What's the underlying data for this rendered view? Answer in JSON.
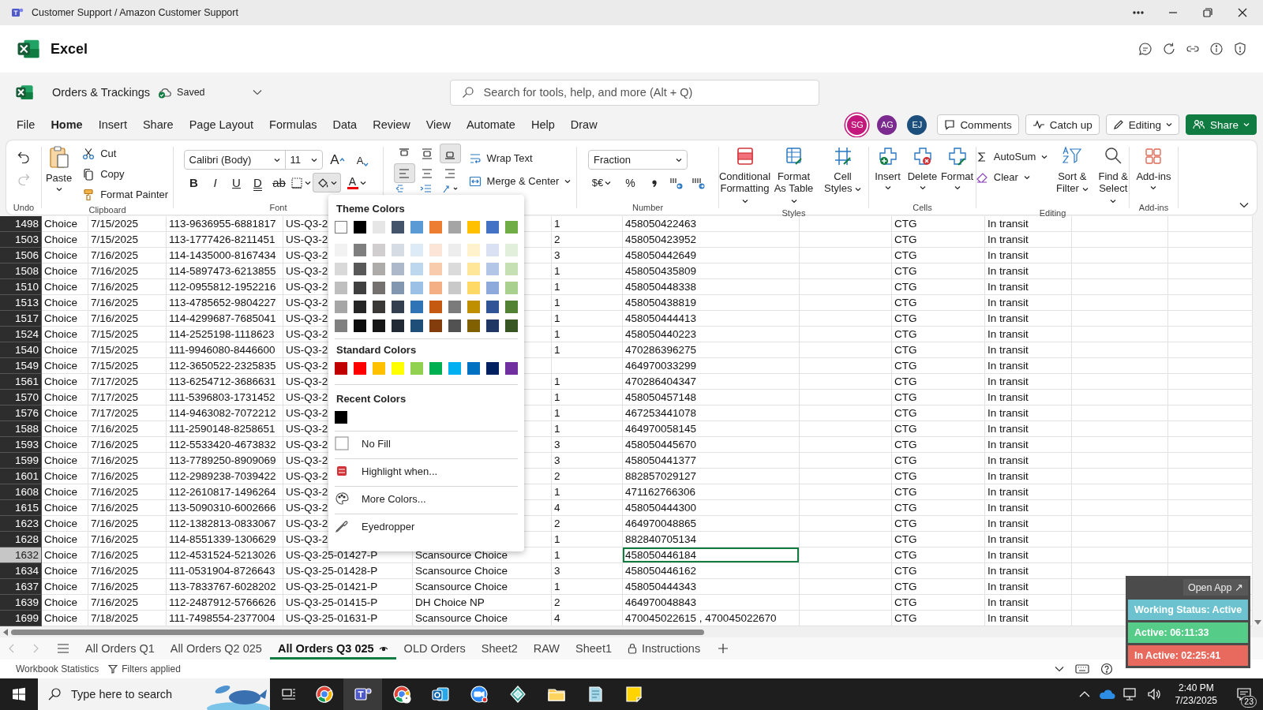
{
  "window": {
    "title": "Customer Support / Amazon Customer Support"
  },
  "app": {
    "name": "Excel"
  },
  "document": {
    "name": "Orders & Trackings",
    "status": "Saved"
  },
  "search": {
    "placeholder": "Search for tools, help, and more (Alt + Q)"
  },
  "menu": [
    {
      "label": "File",
      "selected": false
    },
    {
      "label": "Home",
      "selected": true
    },
    {
      "label": "Insert",
      "selected": false
    },
    {
      "label": "Share",
      "selected": false
    },
    {
      "label": "Page Layout",
      "selected": false
    },
    {
      "label": "Formulas",
      "selected": false
    },
    {
      "label": "Data",
      "selected": false
    },
    {
      "label": "Review",
      "selected": false
    },
    {
      "label": "View",
      "selected": false
    },
    {
      "label": "Automate",
      "selected": false
    },
    {
      "label": "Help",
      "selected": false
    },
    {
      "label": "Draw",
      "selected": false
    }
  ],
  "collaborators": [
    {
      "initials": "SG",
      "color": "#c4177b"
    },
    {
      "initials": "AG",
      "color": "#7b2a8f"
    },
    {
      "initials": "EJ",
      "color": "#1d4f7c"
    }
  ],
  "header_buttons": [
    "Comments",
    "Catch up",
    "Editing"
  ],
  "share_button": "Share",
  "ribbon": {
    "undo": {
      "label": "Undo"
    },
    "clipboard": {
      "label": "Clipboard",
      "paste": "Paste",
      "items": [
        "Cut",
        "Copy",
        "Format Painter"
      ]
    },
    "font": {
      "label": "Font",
      "family": "Calibri (Body)",
      "size": "11",
      "grow": "A",
      "shrink": "A",
      "styles": [
        "B",
        "I",
        "U",
        "D",
        "ab"
      ],
      "color_letter": "A"
    },
    "alignment": {
      "vertical": [
        {
          "selected": false
        },
        {
          "selected": false
        },
        {
          "selected": true
        }
      ],
      "horizontal": [
        {
          "selected": true
        },
        {
          "selected": false
        },
        {
          "selected": false
        }
      ],
      "wrap": "Wrap Text",
      "merge": "Merge & Center"
    },
    "number": {
      "label": "Number",
      "format": "Fraction",
      "currency": "$€",
      "percent": "%"
    },
    "styles": {
      "label": "Styles",
      "items": [
        "Conditional Formatting",
        "Format As Table",
        "Cell Styles"
      ]
    },
    "cells": {
      "label": "Cells",
      "items": [
        "Insert",
        "Delete",
        "Format"
      ]
    },
    "editing": {
      "label": "Editing",
      "autosum": "AutoSum",
      "clear": "Clear",
      "items": [
        "Sort & Filter",
        "Find & Select"
      ]
    },
    "addins": {
      "label": "Add-ins",
      "button": "Add-ins"
    }
  },
  "rows": [
    {
      "row": "1498",
      "selected": false,
      "column_1": "Choice",
      "column_2": "7/15/2025",
      "column_3": "113-9636955-6881817",
      "column_4": "US-Q3-2",
      "column_6": "1",
      "column_7": "458050422463",
      "column_9": "CTG",
      "column_10": "In transit"
    },
    {
      "row": "1503",
      "selected": false,
      "column_1": "Choice",
      "column_2": "7/15/2025",
      "column_3": "113-1777426-8211451",
      "column_4": "US-Q3-2",
      "column_6": "2",
      "column_7": "458050423952",
      "column_9": "CTG",
      "column_10": "In transit"
    },
    {
      "row": "1506",
      "selected": false,
      "column_1": "Choice",
      "column_2": "7/16/2025",
      "column_3": "114-1435000-8167434",
      "column_4": "US-Q3-2",
      "column_6": "3",
      "column_7": "458050442649",
      "column_9": "CTG",
      "column_10": "In transit"
    },
    {
      "row": "1508",
      "selected": false,
      "column_1": "Choice",
      "column_2": "7/16/2025",
      "column_3": "114-5897473-6213855",
      "column_4": "US-Q3-2",
      "column_6": "1",
      "column_7": "458050435809",
      "column_9": "CTG",
      "column_10": "In transit"
    },
    {
      "row": "1510",
      "selected": false,
      "column_1": "Choice",
      "column_2": "7/16/2025",
      "column_3": "112-0955812-1952216",
      "column_4": "US-Q3-2",
      "column_6": "1",
      "column_7": "458050448338",
      "column_9": "CTG",
      "column_10": "In transit"
    },
    {
      "row": "1513",
      "selected": false,
      "column_1": "Choice",
      "column_2": "7/16/2025",
      "column_3": "113-4785652-9804227",
      "column_4": "US-Q3-2",
      "column_6": "1",
      "column_7": "458050438819",
      "column_9": "CTG",
      "column_10": "In transit"
    },
    {
      "row": "1517",
      "selected": false,
      "column_1": "Choice",
      "column_2": "7/16/2025",
      "column_3": "114-4299687-7685041",
      "column_4": "US-Q3-2",
      "column_6": "1",
      "column_7": "458050444413",
      "column_9": "CTG",
      "column_10": "In transit"
    },
    {
      "row": "1524",
      "selected": false,
      "column_1": "Choice",
      "column_2": "7/15/2025",
      "column_3": "114-2525198-1118623",
      "column_4": "US-Q3-2",
      "column_6": "1",
      "column_7": "458050440223",
      "column_9": "CTG",
      "column_10": "In transit"
    },
    {
      "row": "1540",
      "selected": false,
      "column_1": "Choice",
      "column_2": "7/15/2025",
      "column_3": "111-9946080-8446600",
      "column_4": "US-Q3-2",
      "column_6": "1",
      "column_7": "470286396275",
      "column_9": "CTG",
      "column_10": "In transit"
    },
    {
      "row": "1549",
      "selected": false,
      "column_1": "Choice",
      "column_2": "7/15/2025",
      "column_3": "112-3650522-2325835",
      "column_4": "US-Q3-2",
      "column_7": "464970033299",
      "column_9": "CTG",
      "column_10": "In transit"
    },
    {
      "row": "1561",
      "selected": false,
      "column_1": "Choice",
      "column_2": "7/17/2025",
      "column_3": "113-6254712-3686631",
      "column_4": "US-Q3-2",
      "column_6": "1",
      "column_7": "470286404347",
      "column_9": "CTG",
      "column_10": "In transit"
    },
    {
      "row": "1570",
      "selected": false,
      "column_1": "Choice",
      "column_2": "7/17/2025",
      "column_3": "111-5396803-1731452",
      "column_4": "US-Q3-2",
      "column_6": "1",
      "column_7": "458050457148",
      "column_9": "CTG",
      "column_10": "In transit"
    },
    {
      "row": "1576",
      "selected": false,
      "column_1": "Choice",
      "column_2": "7/17/2025",
      "column_3": "114-9463082-7072212",
      "column_4": "US-Q3-2",
      "column_6": "1",
      "column_7": "467253441078",
      "column_9": "CTG",
      "column_10": "In transit"
    },
    {
      "row": "1588",
      "selected": false,
      "column_1": "Choice",
      "column_2": "7/16/2025",
      "column_3": "111-2590148-8258651",
      "column_4": "US-Q3-2",
      "column_6": "1",
      "column_7": "464970058145",
      "column_9": "CTG",
      "column_10": "In transit"
    },
    {
      "row": "1593",
      "selected": false,
      "column_1": "Choice",
      "column_2": "7/16/2025",
      "column_3": "112-5533420-4673832",
      "column_4": "US-Q3-2",
      "column_6": "3",
      "column_7": "458050445670",
      "column_9": "CTG",
      "column_10": "In transit"
    },
    {
      "row": "1599",
      "selected": false,
      "column_1": "Choice",
      "column_2": "7/16/2025",
      "column_3": "113-7789250-8909069",
      "column_4": "US-Q3-2",
      "column_6": "3",
      "column_7": "458050441377",
      "column_9": "CTG",
      "column_10": "In transit"
    },
    {
      "row": "1601",
      "selected": false,
      "column_1": "Choice",
      "column_2": "7/16/2025",
      "column_3": "112-2989238-7039422",
      "column_4": "US-Q3-2",
      "column_6": "2",
      "column_7": "882857029127",
      "column_9": "CTG",
      "column_10": "In transit"
    },
    {
      "row": "1608",
      "selected": false,
      "column_1": "Choice",
      "column_2": "7/16/2025",
      "column_3": "112-2610817-1496264",
      "column_4": "US-Q3-2",
      "column_6": "1",
      "column_7": "471162766306",
      "column_9": "CTG",
      "column_10": "In transit"
    },
    {
      "row": "1615",
      "selected": false,
      "column_1": "Choice",
      "column_2": "7/16/2025",
      "column_3": "113-5090310-6002666",
      "column_4": "US-Q3-2",
      "column_6": "4",
      "column_7": "458050444300",
      "column_9": "CTG",
      "column_10": "In transit"
    },
    {
      "row": "1623",
      "selected": false,
      "column_1": "Choice",
      "column_2": "7/16/2025",
      "column_3": "112-1382813-0833067",
      "column_4": "US-Q3-2",
      "column_6": "2",
      "column_7": "464970048865",
      "column_9": "CTG",
      "column_10": "In transit"
    },
    {
      "row": "1628",
      "selected": false,
      "column_1": "Choice",
      "column_2": "7/16/2025",
      "column_3": "114-8551339-1306629",
      "column_4": "US-Q3-2",
      "column_6": "1",
      "column_7": "882840705134",
      "column_9": "CTG",
      "column_10": "In transit"
    },
    {
      "row": "1632",
      "selected": true,
      "column_1": "Choice",
      "column_2": "7/16/2025",
      "column_3": "112-4531524-5213026",
      "column_4": "US-Q3-25-01427-P",
      "column_5": "Scansource Choice",
      "column_6": "1",
      "column_7": "458050446184",
      "column_9": "CTG",
      "column_10": "In transit"
    },
    {
      "row": "1634",
      "selected": false,
      "column_1": "Choice",
      "column_2": "7/16/2025",
      "column_3": "111-0531904-8726643",
      "column_4": "US-Q3-25-01428-P",
      "column_5": "Scansource Choice",
      "column_6": "3",
      "column_7": "458050446162",
      "column_9": "CTG",
      "column_10": "In transit"
    },
    {
      "row": "1637",
      "selected": false,
      "column_1": "Choice",
      "column_2": "7/16/2025",
      "column_3": "113-7833767-6028202",
      "column_4": "US-Q3-25-01421-P",
      "column_5": "Scansource Choice",
      "column_6": "1",
      "column_7": "458050444343",
      "column_9": "CTG",
      "column_10": "In transit"
    },
    {
      "row": "1639",
      "selected": false,
      "column_1": "Choice",
      "column_2": "7/16/2025",
      "column_3": "112-2487912-5766626",
      "column_4": "US-Q3-25-01415-P",
      "column_5": "DH Choice NP",
      "column_6": "2",
      "column_7": "464970048843",
      "column_9": "CTG",
      "column_10": "In transit"
    },
    {
      "row": "1699",
      "selected": false,
      "column_1": "Choice",
      "column_2": "7/18/2025",
      "column_3": "111-7498554-2377004",
      "column_4": "US-Q3-25-01631-P",
      "column_5": "Scansource Choice",
      "column_6": "4",
      "column_7": "470045022615 , 470045022670",
      "column_9": "CTG",
      "column_10": "In transit"
    }
  ],
  "fill_menu": {
    "theme_title": "Theme Colors",
    "theme_colors": [
      [
        {
          "color": "#ffffff",
          "selected": true
        },
        {
          "color": "#000000",
          "selected": false
        },
        {
          "color": "#e7e6e6",
          "selected": false
        },
        {
          "color": "#44546a",
          "selected": false
        },
        {
          "color": "#5b9bd5",
          "selected": false
        },
        {
          "color": "#ed7d31",
          "selected": false
        },
        {
          "color": "#a5a5a5",
          "selected": false
        },
        {
          "color": "#ffc000",
          "selected": false
        },
        {
          "color": "#4472c4",
          "selected": false
        },
        {
          "color": "#70ad47",
          "selected": false
        }
      ],
      [
        {
          "color": "#f2f2f2",
          "selected": false
        },
        {
          "color": "#7f7f7f",
          "selected": false
        },
        {
          "color": "#d0cece",
          "selected": false
        },
        {
          "color": "#d6dce4",
          "selected": false
        },
        {
          "color": "#ddebf7",
          "selected": false
        },
        {
          "color": "#fce4d6",
          "selected": false
        },
        {
          "color": "#ededed",
          "selected": false
        },
        {
          "color": "#fff2cc",
          "selected": false
        },
        {
          "color": "#d9e1f2",
          "selected": false
        },
        {
          "color": "#e2efda",
          "selected": false
        }
      ],
      [
        {
          "color": "#d9d9d9",
          "selected": false
        },
        {
          "color": "#595959",
          "selected": false
        },
        {
          "color": "#aeabab",
          "selected": false
        },
        {
          "color": "#adb9ca",
          "selected": false
        },
        {
          "color": "#bdd7ee",
          "selected": false
        },
        {
          "color": "#f8cbad",
          "selected": false
        },
        {
          "color": "#dbdbdb",
          "selected": false
        },
        {
          "color": "#ffe699",
          "selected": false
        },
        {
          "color": "#b4c6e7",
          "selected": false
        },
        {
          "color": "#c6e0b4",
          "selected": false
        }
      ],
      [
        {
          "color": "#bfbfbf",
          "selected": false
        },
        {
          "color": "#404040",
          "selected": false
        },
        {
          "color": "#757171",
          "selected": false
        },
        {
          "color": "#8497b0",
          "selected": false
        },
        {
          "color": "#9bc2e6",
          "selected": false
        },
        {
          "color": "#f4b084",
          "selected": false
        },
        {
          "color": "#c9c9c9",
          "selected": false
        },
        {
          "color": "#ffd966",
          "selected": false
        },
        {
          "color": "#8ea9db",
          "selected": false
        },
        {
          "color": "#a9d08e",
          "selected": false
        }
      ],
      [
        {
          "color": "#a6a6a6",
          "selected": false
        },
        {
          "color": "#262626",
          "selected": false
        },
        {
          "color": "#3b3838",
          "selected": false
        },
        {
          "color": "#333f4f",
          "selected": false
        },
        {
          "color": "#2f75b5",
          "selected": false
        },
        {
          "color": "#c65911",
          "selected": false
        },
        {
          "color": "#7b7b7b",
          "selected": false
        },
        {
          "color": "#bf8f00",
          "selected": false
        },
        {
          "color": "#305496",
          "selected": false
        },
        {
          "color": "#548235",
          "selected": false
        }
      ],
      [
        {
          "color": "#808080",
          "selected": false
        },
        {
          "color": "#0d0d0d",
          "selected": false
        },
        {
          "color": "#181717",
          "selected": false
        },
        {
          "color": "#222a35",
          "selected": false
        },
        {
          "color": "#1f4e78",
          "selected": false
        },
        {
          "color": "#833c0c",
          "selected": false
        },
        {
          "color": "#525252",
          "selected": false
        },
        {
          "color": "#806000",
          "selected": false
        },
        {
          "color": "#203764",
          "selected": false
        },
        {
          "color": "#375623",
          "selected": false
        }
      ]
    ],
    "standard_title": "Standard Colors",
    "standard_colors": [
      {
        "color": "#c00000",
        "selected": false
      },
      {
        "color": "#ff0000",
        "selected": false
      },
      {
        "color": "#ffc000",
        "selected": false
      },
      {
        "color": "#ffff00",
        "selected": false
      },
      {
        "color": "#92d050",
        "selected": false
      },
      {
        "color": "#00b050",
        "selected": false
      },
      {
        "color": "#00b0f0",
        "selected": false
      },
      {
        "color": "#0070c0",
        "selected": false
      },
      {
        "color": "#002060",
        "selected": false
      },
      {
        "color": "#7030a0",
        "selected": false
      }
    ],
    "recent_title": "Recent Colors",
    "recent_colors": [
      {
        "color": "#000000",
        "selected": false
      }
    ],
    "items": [
      "No Fill",
      "Highlight when...",
      "More Colors...",
      "Eyedropper"
    ]
  },
  "sheet_tabs": [
    {
      "label": "All Orders Q1",
      "selected": false,
      "kind": "plain"
    },
    {
      "label": "All Orders Q2 025",
      "selected": false,
      "kind": "plain"
    },
    {
      "label": "All Orders Q3 025",
      "selected": true,
      "kind": "viewing"
    },
    {
      "label": "OLD Orders",
      "selected": false,
      "kind": "plain"
    },
    {
      "label": "Sheet2",
      "selected": false,
      "kind": "plain"
    },
    {
      "label": "RAW",
      "selected": false,
      "kind": "plain"
    },
    {
      "label": "Sheet1",
      "selected": false,
      "kind": "plain"
    },
    {
      "label": "Instructions",
      "selected": false,
      "kind": "protected"
    }
  ],
  "status_bar": {
    "items": [
      "Workbook Statistics",
      "Filters applied"
    ]
  },
  "widget": {
    "open_label": "Open App ↗",
    "items": [
      {
        "label": "Working Status: Active",
        "color": "#6cc3cf"
      },
      {
        "label": "Active: 06:11:33",
        "color": "#55cc88"
      },
      {
        "label": "In Active: 02:25:41",
        "color": "#e8695e"
      }
    ]
  },
  "taskbar": {
    "search_placeholder": "Type here to search",
    "apps": [
      {
        "active": false
      },
      {
        "active": true
      },
      {
        "active": false
      },
      {
        "active": false
      },
      {
        "active": false
      },
      {
        "active": false
      },
      {
        "active": false
      },
      {
        "active": false
      },
      {
        "active": false
      }
    ],
    "time": "2:40 PM",
    "date": "7/23/2025",
    "notifications": "23"
  }
}
